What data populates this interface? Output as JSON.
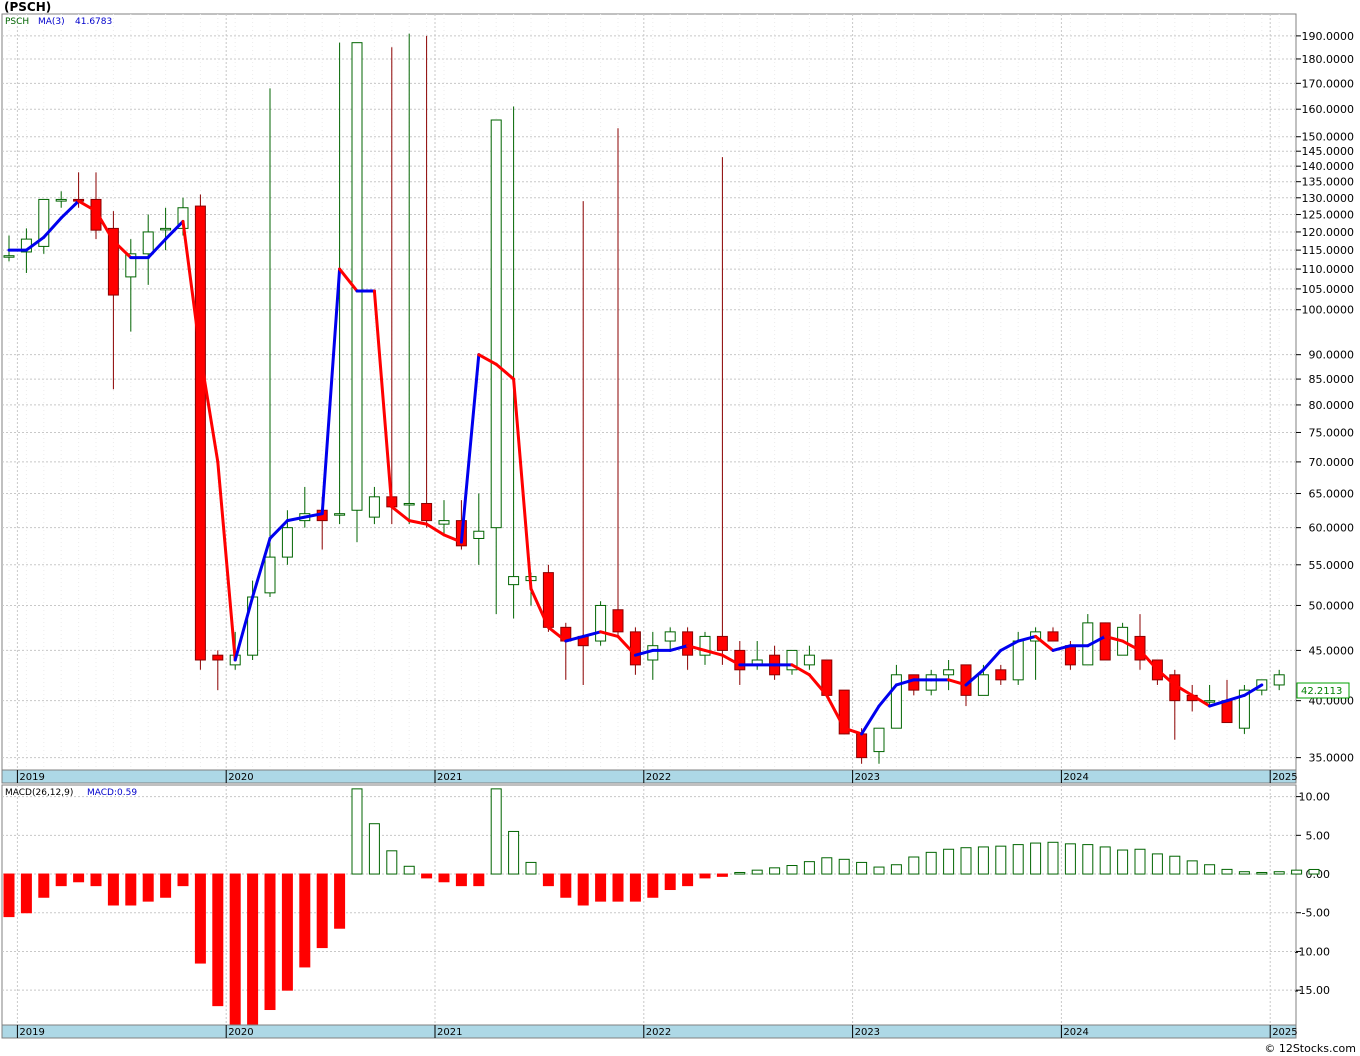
{
  "title": "(PSCH)",
  "credit": "© 12Stocks.com",
  "colors": {
    "up": "#006400",
    "down": "#ff0000",
    "downWick": "#8b0000",
    "maUp": "#0000ee",
    "maDown": "#ff0000",
    "grid": "#c8c8c8",
    "axisBand": "#add8e6",
    "lastPrice": "#00a000"
  },
  "price_panel": {
    "legend_symbol": "PSCH",
    "legend_ma": "MA(3)",
    "legend_ma_value": "41.6783",
    "last_price": "42.2113",
    "y_ticks": [
      "35.0000",
      "40.0000",
      "45.0000",
      "50.0000",
      "55.0000",
      "60.0000",
      "65.0000",
      "70.0000",
      "75.0000",
      "80.0000",
      "85.0000",
      "90.0000",
      "100.0000",
      "105.0000",
      "110.0000",
      "115.0000",
      "120.0000",
      "125.0000",
      "130.0000",
      "135.0000",
      "140.0000",
      "145.0000",
      "150.0000",
      "160.0000",
      "170.0000",
      "180.0000",
      "190.0000"
    ],
    "x_labels": [
      "2019",
      "2020",
      "2021",
      "2022",
      "2023",
      "2024",
      "2025"
    ]
  },
  "macd_panel": {
    "legend_label": "MACD(26,12,9)",
    "legend_value": "MACD:0.59",
    "y_ticks": [
      "10.00",
      "5.00",
      "0.00",
      "-5.00",
      "-10.00",
      "-15.00"
    ],
    "x_labels": [
      "2019",
      "2020",
      "2021",
      "2022",
      "2023",
      "2024",
      "2025"
    ]
  },
  "chart_data": [
    {
      "type": "candlestick",
      "title": "(PSCH)",
      "period": "monthly",
      "y_scale": "log",
      "ylim": [
        34,
        200
      ],
      "xlim": [
        "2018-12",
        "2025-09"
      ],
      "candles": [
        {
          "x": "2018-12",
          "o": 113.5,
          "h": 119,
          "l": 112,
          "c": 113.5
        },
        {
          "x": "2019-01",
          "o": 114.5,
          "h": 121,
          "l": 109,
          "c": 118
        },
        {
          "x": "2019-02",
          "o": 116,
          "h": 122,
          "l": 114,
          "c": 129.5
        },
        {
          "x": "2019-03",
          "o": 129,
          "h": 132,
          "l": 127,
          "c": 129.5
        },
        {
          "x": "2019-04",
          "o": 129.5,
          "h": 138,
          "l": 127,
          "c": 129
        },
        {
          "x": "2019-05",
          "o": 129.5,
          "h": 138,
          "l": 118,
          "c": 120.5
        },
        {
          "x": "2019-06",
          "o": 121,
          "h": 126,
          "l": 83,
          "c": 103.5
        },
        {
          "x": "2019-07",
          "o": 108,
          "h": 118,
          "l": 95,
          "c": 114
        },
        {
          "x": "2019-08",
          "o": 114,
          "h": 125,
          "l": 106,
          "c": 120
        },
        {
          "x": "2019-09",
          "o": 121,
          "h": 127,
          "l": 115,
          "c": 121
        },
        {
          "x": "2019-10",
          "o": 121,
          "h": 130,
          "l": 119,
          "c": 127
        },
        {
          "x": "2019-11",
          "o": 127.5,
          "h": 131,
          "l": 43,
          "c": 44
        },
        {
          "x": "2019-12",
          "o": 44.5,
          "h": 45,
          "l": 41,
          "c": 44
        },
        {
          "x": "2020-01",
          "o": 43.5,
          "h": 47,
          "l": 43,
          "c": 44.5
        },
        {
          "x": "2020-02",
          "o": 44.5,
          "h": 53,
          "l": 44,
          "c": 51
        },
        {
          "x": "2020-03",
          "o": 51.5,
          "h": 168,
          "l": 51,
          "c": 56
        },
        {
          "x": "2020-04",
          "o": 56,
          "h": 62.5,
          "l": 55,
          "c": 60
        },
        {
          "x": "2020-05",
          "o": 61,
          "h": 66,
          "l": 60,
          "c": 62
        },
        {
          "x": "2020-06",
          "o": 62.5,
          "h": 64.5,
          "l": 57,
          "c": 61
        },
        {
          "x": "2020-07",
          "o": 62,
          "h": 187,
          "l": 60.5,
          "c": 62
        },
        {
          "x": "2020-08",
          "o": 62.5,
          "h": 187,
          "l": 58,
          "c": 187
        },
        {
          "x": "2020-09",
          "o": 61.5,
          "h": 66,
          "l": 60.5,
          "c": 64.5
        },
        {
          "x": "2020-10",
          "o": 64.5,
          "h": 185,
          "l": 60.5,
          "c": 63
        },
        {
          "x": "2020-11",
          "o": 63.5,
          "h": 191,
          "l": 60.5,
          "c": 63.5
        },
        {
          "x": "2020-12",
          "o": 63.5,
          "h": 190,
          "l": 60,
          "c": 61
        },
        {
          "x": "2021-01",
          "o": 60.5,
          "h": 64,
          "l": 59,
          "c": 61
        },
        {
          "x": "2021-02",
          "o": 61,
          "h": 64,
          "l": 57,
          "c": 57.5
        },
        {
          "x": "2021-03",
          "o": 58.5,
          "h": 65,
          "l": 55,
          "c": 59.5
        },
        {
          "x": "2021-04",
          "o": 60,
          "h": 60,
          "l": 49,
          "c": 156
        },
        {
          "x": "2021-05",
          "o": 52.5,
          "h": 161,
          "l": 48.5,
          "c": 53.5
        },
        {
          "x": "2021-06",
          "o": 53,
          "h": 54,
          "l": 50,
          "c": 53.5
        },
        {
          "x": "2021-07",
          "o": 54,
          "h": 55,
          "l": 47,
          "c": 47.5
        },
        {
          "x": "2021-08",
          "o": 47.5,
          "h": 48,
          "l": 42,
          "c": 46
        },
        {
          "x": "2021-09",
          "o": 46.5,
          "h": 129,
          "l": 41.5,
          "c": 45.5
        },
        {
          "x": "2021-10",
          "o": 46,
          "h": 50.5,
          "l": 45.5,
          "c": 50
        },
        {
          "x": "2021-11",
          "o": 49.5,
          "h": 153,
          "l": 46.5,
          "c": 47
        },
        {
          "x": "2021-12",
          "o": 47,
          "h": 47.5,
          "l": 42.5,
          "c": 43.5
        },
        {
          "x": "2022-01",
          "o": 44,
          "h": 47,
          "l": 42,
          "c": 45.5
        },
        {
          "x": "2022-02",
          "o": 46,
          "h": 47.5,
          "l": 45,
          "c": 47
        },
        {
          "x": "2022-03",
          "o": 47,
          "h": 47.5,
          "l": 43,
          "c": 44.5
        },
        {
          "x": "2022-04",
          "o": 44.5,
          "h": 47,
          "l": 43.5,
          "c": 46.5
        },
        {
          "x": "2022-05",
          "o": 46.5,
          "h": 143,
          "l": 43.5,
          "c": 45
        },
        {
          "x": "2022-06",
          "o": 45,
          "h": 46,
          "l": 41.5,
          "c": 43
        },
        {
          "x": "2022-07",
          "o": 43.5,
          "h": 46,
          "l": 43,
          "c": 44
        },
        {
          "x": "2022-08",
          "o": 44.5,
          "h": 45.5,
          "l": 42,
          "c": 42.5
        },
        {
          "x": "2022-09",
          "o": 43,
          "h": 45,
          "l": 42.5,
          "c": 45
        },
        {
          "x": "2022-10",
          "o": 43.5,
          "h": 45.5,
          "l": 43,
          "c": 44.5
        },
        {
          "x": "2022-11",
          "o": 44,
          "h": 44,
          "l": 40.5,
          "c": 40.5
        },
        {
          "x": "2022-12",
          "o": 41,
          "h": 41,
          "l": 37,
          "c": 37
        },
        {
          "x": "2023-01",
          "o": 37,
          "h": 37.5,
          "l": 34.5,
          "c": 35
        },
        {
          "x": "2023-02",
          "o": 35.5,
          "h": 37.5,
          "l": 34.5,
          "c": 37.5
        },
        {
          "x": "2023-03",
          "o": 37.5,
          "h": 43.5,
          "l": 37.5,
          "c": 42.5
        },
        {
          "x": "2023-04",
          "o": 42.5,
          "h": 42.5,
          "l": 40.5,
          "c": 41
        },
        {
          "x": "2023-05",
          "o": 41,
          "h": 43,
          "l": 40.5,
          "c": 42.5
        },
        {
          "x": "2023-06",
          "o": 42.5,
          "h": 44,
          "l": 41,
          "c": 43
        },
        {
          "x": "2023-07",
          "o": 43.5,
          "h": 43.5,
          "l": 39.5,
          "c": 40.5
        },
        {
          "x": "2023-08",
          "o": 40.5,
          "h": 43.5,
          "l": 40.5,
          "c": 42.5
        },
        {
          "x": "2023-09",
          "o": 43,
          "h": 43.5,
          "l": 41.5,
          "c": 42
        },
        {
          "x": "2023-10",
          "o": 42,
          "h": 47,
          "l": 41.5,
          "c": 46
        },
        {
          "x": "2023-11",
          "o": 46,
          "h": 47.5,
          "l": 42,
          "c": 47
        },
        {
          "x": "2023-12",
          "o": 47,
          "h": 47.5,
          "l": 46,
          "c": 46
        },
        {
          "x": "2024-01",
          "o": 45.5,
          "h": 46,
          "l": 43,
          "c": 43.5
        },
        {
          "x": "2024-02",
          "o": 43.5,
          "h": 49,
          "l": 43.5,
          "c": 48
        },
        {
          "x": "2024-03",
          "o": 48,
          "h": 48,
          "l": 44,
          "c": 44
        },
        {
          "x": "2024-04",
          "o": 44.5,
          "h": 48,
          "l": 44.5,
          "c": 47.5
        },
        {
          "x": "2024-05",
          "o": 46.5,
          "h": 49,
          "l": 43,
          "c": 44
        },
        {
          "x": "2024-06",
          "o": 44,
          "h": 44,
          "l": 41.5,
          "c": 42
        },
        {
          "x": "2024-07",
          "o": 42.5,
          "h": 43,
          "l": 36.5,
          "c": 40
        },
        {
          "x": "2024-08",
          "o": 40.5,
          "h": 41.5,
          "l": 39,
          "c": 40
        },
        {
          "x": "2024-09",
          "o": 40,
          "h": 41.5,
          "l": 39.5,
          "c": 40
        },
        {
          "x": "2024-10",
          "o": 40,
          "h": 42,
          "l": 38,
          "c": 38
        },
        {
          "x": "2024-11",
          "o": 37.5,
          "h": 41.5,
          "l": 37,
          "c": 41
        },
        {
          "x": "2024-12",
          "o": 41,
          "h": 42,
          "l": 40.5,
          "c": 42
        },
        {
          "x": "2025-01",
          "o": 41.5,
          "h": 43,
          "l": 41,
          "c": 42.5
        }
      ],
      "ma": {
        "name": "MA(3)",
        "values": [
          115,
          115,
          118.5,
          124,
          129,
          126,
          117.5,
          113,
          113,
          118,
          123,
          90,
          70,
          44,
          51,
          58.5,
          61,
          61.5,
          62,
          110,
          104.5,
          104.5,
          63,
          61,
          60.5,
          59,
          58,
          90,
          88,
          85,
          52,
          47.5,
          46,
          46.5,
          47,
          46.5,
          44.5,
          45,
          45,
          45.5,
          45,
          44.5,
          43.5,
          43.5,
          43.5,
          43.5,
          42.5,
          40.5,
          37.5,
          37,
          39.5,
          41.5,
          42,
          42,
          42,
          41.5,
          43,
          45,
          46,
          46.5,
          45,
          45.5,
          45.5,
          46.5,
          46,
          45,
          43,
          41.5,
          40.5,
          39.5,
          40,
          40.5,
          41.5
        ],
        "color_rule": "blue when rising, red when falling"
      }
    },
    {
      "type": "bar",
      "title": "MACD(26,12,9)",
      "ylim": [
        -19.5,
        11.5
      ],
      "values": [
        -5.5,
        -5,
        -3,
        -1.5,
        -1,
        -1.5,
        -4,
        -4,
        -3.5,
        -3,
        -1.5,
        -11.5,
        -17,
        -19.5,
        -19.5,
        -17.5,
        -15,
        -12,
        -9.5,
        -7,
        11,
        6.5,
        3,
        1,
        -0.5,
        -1,
        -1.5,
        -1.5,
        11,
        5.5,
        1.5,
        -1.5,
        -3,
        -4,
        -3.5,
        -3.5,
        -3.5,
        -3,
        -2,
        -1.5,
        -0.5,
        -0.3,
        0.2,
        0.5,
        0.8,
        1.1,
        1.6,
        2.1,
        1.9,
        1.5,
        0.9,
        1.2,
        2.2,
        2.8,
        3.2,
        3.4,
        3.5,
        3.6,
        3.8,
        4.0,
        4.1,
        3.9,
        3.8,
        3.5,
        3.1,
        3.2,
        2.6,
        2.3,
        1.7,
        1.2,
        0.6,
        0.3,
        0.2,
        0.3,
        0.5,
        0.59
      ]
    }
  ]
}
